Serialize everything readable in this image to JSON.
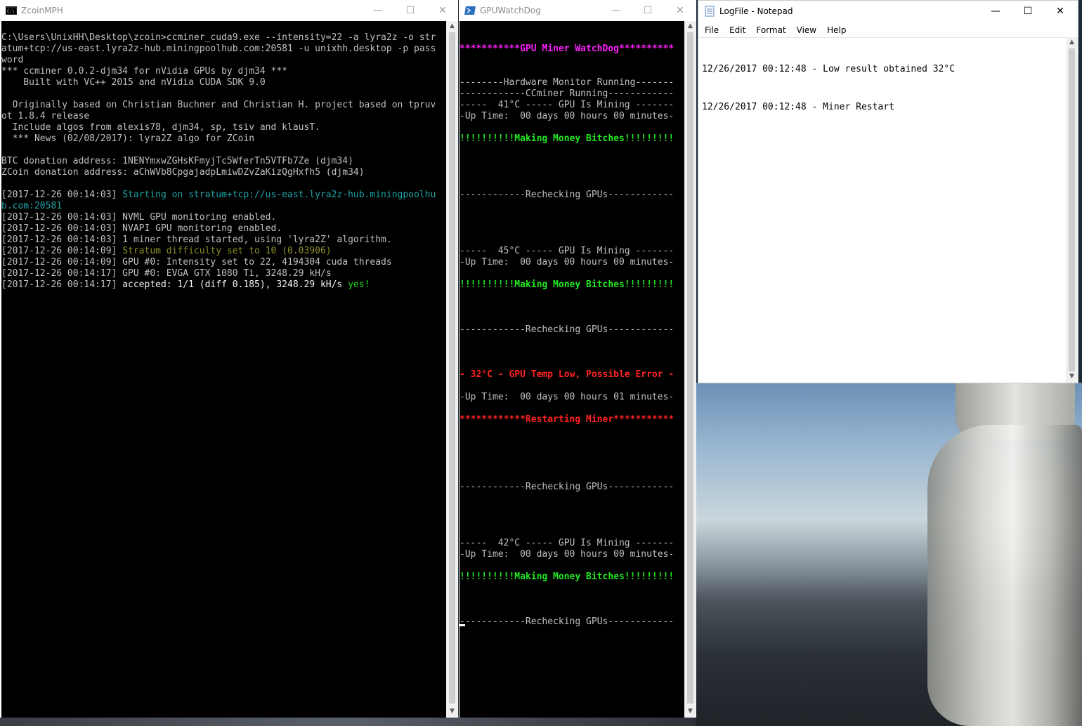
{
  "zcoin_window": {
    "title": "ZcoinMPH",
    "lines": [
      {
        "parts": [
          {
            "t": "C:\\Users\\UnixHH\\Desktop\\zcoin>ccminer_cuda9.exe --intensity=22 -a lyra2z -o str",
            "c": "c-grey"
          }
        ]
      },
      {
        "parts": [
          {
            "t": "atum+tcp://us-east.lyra2z-hub.miningpoolhub.com:20581 -u unixhh.desktop -p pass",
            "c": "c-grey"
          }
        ]
      },
      {
        "parts": [
          {
            "t": "word",
            "c": "c-grey"
          }
        ]
      },
      {
        "parts": [
          {
            "t": "*** ccminer 0.0.2-djm34 for nVidia GPUs by djm34 ***",
            "c": "c-grey"
          }
        ]
      },
      {
        "parts": [
          {
            "t": "    Built with VC++ 2015 and nVidia CUDA SDK 9.0",
            "c": "c-grey"
          }
        ]
      },
      {
        "parts": [
          {
            "t": "",
            "c": "c-grey"
          }
        ]
      },
      {
        "parts": [
          {
            "t": "  Originally based on Christian Buchner and Christian H. project based on tpruv",
            "c": "c-grey"
          }
        ]
      },
      {
        "parts": [
          {
            "t": "ot 1.8.4 release",
            "c": "c-grey"
          }
        ]
      },
      {
        "parts": [
          {
            "t": "  Include algos from alexis78, djm34, sp, tsiv and klausT.",
            "c": "c-grey"
          }
        ]
      },
      {
        "parts": [
          {
            "t": "  *** News (02/08/2017): lyra2Z algo for ZCoin",
            "c": "c-grey"
          }
        ]
      },
      {
        "parts": [
          {
            "t": "",
            "c": "c-grey"
          }
        ]
      },
      {
        "parts": [
          {
            "t": "BTC donation address: 1NENYmxwZGHsKFmyjTc5WferTn5VTFb7Ze (djm34)",
            "c": "c-grey"
          }
        ]
      },
      {
        "parts": [
          {
            "t": "ZCoin donation address: aChWVb8CpgajadpLmiwDZvZaKizQgHxfh5 (djm34)",
            "c": "c-grey"
          }
        ]
      },
      {
        "parts": [
          {
            "t": "",
            "c": "c-grey"
          }
        ]
      },
      {
        "parts": [
          {
            "t": "[2017-12-26 00:14:03] ",
            "c": "c-grey"
          },
          {
            "t": "Starting on stratum+tcp://us-east.lyra2z-hub.miningpoolhu",
            "c": "c-cyan"
          }
        ]
      },
      {
        "parts": [
          {
            "t": "b.com:20581",
            "c": "c-cyan"
          }
        ]
      },
      {
        "parts": [
          {
            "t": "[2017-12-26 00:14:03] NVML GPU monitoring enabled.",
            "c": "c-grey"
          }
        ]
      },
      {
        "parts": [
          {
            "t": "[2017-12-26 00:14:03] NVAPI GPU monitoring enabled.",
            "c": "c-grey"
          }
        ]
      },
      {
        "parts": [
          {
            "t": "[2017-12-26 00:14:03] 1 miner thread started, using 'lyra2Z' algorithm.",
            "c": "c-grey"
          }
        ]
      },
      {
        "parts": [
          {
            "t": "[2017-12-26 00:14:09] ",
            "c": "c-grey"
          },
          {
            "t": "Stratum difficulty set to 10 (0.03906)",
            "c": "c-yellow"
          }
        ]
      },
      {
        "parts": [
          {
            "t": "[2017-12-26 00:14:09] GPU #0: Intensity set to 22, 4194304 cuda threads",
            "c": "c-grey"
          }
        ]
      },
      {
        "parts": [
          {
            "t": "[2017-12-26 00:14:17] GPU #0: EVGA GTX 1080 Ti, 3248.29 kH/s",
            "c": "c-grey"
          }
        ]
      },
      {
        "parts": [
          {
            "t": "[2017-12-26 00:14:17] ",
            "c": "c-grey"
          },
          {
            "t": "accepted: 1/1 (diff 0.185), 3248.29 kH/s ",
            "c": "c-white"
          },
          {
            "t": "yes!",
            "c": "c-green"
          }
        ]
      }
    ]
  },
  "watchdog_window": {
    "title": "GPUWatchDog",
    "lines": [
      {
        "t": "",
        "c": "c-grey"
      },
      {
        "t": "",
        "c": "c-grey"
      },
      {
        "t": "***********GPU Miner WatchDog**********",
        "c": "c-magenta"
      },
      {
        "t": "",
        "c": "c-grey"
      },
      {
        "t": "",
        "c": "c-grey"
      },
      {
        "t": "--------Hardware Monitor Running-------",
        "c": "c-grey"
      },
      {
        "t": "------------CCminer Running------------",
        "c": "c-grey"
      },
      {
        "t": "-----  41°C ----- GPU Is Mining -------",
        "c": "c-grey"
      },
      {
        "t": "-Up Time:  00 days 00 hours 00 minutes-",
        "c": "c-grey"
      },
      {
        "t": "",
        "c": "c-grey"
      },
      {
        "t": "!!!!!!!!!!Making Money Bitches!!!!!!!!!",
        "c": "c-lgreen"
      },
      {
        "t": "",
        "c": "c-grey"
      },
      {
        "t": "",
        "c": "c-grey"
      },
      {
        "t": "",
        "c": "c-grey"
      },
      {
        "t": "",
        "c": "c-grey"
      },
      {
        "t": "------------Rechecking GPUs------------",
        "c": "c-grey"
      },
      {
        "t": "",
        "c": "c-grey"
      },
      {
        "t": "",
        "c": "c-grey"
      },
      {
        "t": "",
        "c": "c-grey"
      },
      {
        "t": "",
        "c": "c-grey"
      },
      {
        "t": "-----  45°C ----- GPU Is Mining -------",
        "c": "c-grey"
      },
      {
        "t": "-Up Time:  00 days 00 hours 00 minutes-",
        "c": "c-grey"
      },
      {
        "t": "",
        "c": "c-grey"
      },
      {
        "t": "!!!!!!!!!!Making Money Bitches!!!!!!!!!",
        "c": "c-lgreen"
      },
      {
        "t": "",
        "c": "c-grey"
      },
      {
        "t": "",
        "c": "c-grey"
      },
      {
        "t": "",
        "c": "c-grey"
      },
      {
        "t": "------------Rechecking GPUs------------",
        "c": "c-grey"
      },
      {
        "t": "",
        "c": "c-grey"
      },
      {
        "t": "",
        "c": "c-grey"
      },
      {
        "t": "",
        "c": "c-grey"
      },
      {
        "t": "- 32°C - GPU Temp Low, Possible Error -",
        "c": "c-red"
      },
      {
        "t": "",
        "c": "c-grey"
      },
      {
        "t": "-Up Time:  00 days 00 hours 01 minutes-",
        "c": "c-grey"
      },
      {
        "t": "",
        "c": "c-grey"
      },
      {
        "t": "************Restarting Miner***********",
        "c": "c-red"
      },
      {
        "t": "",
        "c": "c-grey"
      },
      {
        "t": "",
        "c": "c-grey"
      },
      {
        "t": "",
        "c": "c-grey"
      },
      {
        "t": "",
        "c": "c-grey"
      },
      {
        "t": "",
        "c": "c-grey"
      },
      {
        "t": "------------Rechecking GPUs------------",
        "c": "c-grey"
      },
      {
        "t": "",
        "c": "c-grey"
      },
      {
        "t": "",
        "c": "c-grey"
      },
      {
        "t": "",
        "c": "c-grey"
      },
      {
        "t": "",
        "c": "c-grey"
      },
      {
        "t": "-----  42°C ----- GPU Is Mining -------",
        "c": "c-grey"
      },
      {
        "t": "-Up Time:  00 days 00 hours 00 minutes-",
        "c": "c-grey"
      },
      {
        "t": "",
        "c": "c-grey"
      },
      {
        "t": "!!!!!!!!!!Making Money Bitches!!!!!!!!!",
        "c": "c-lgreen"
      },
      {
        "t": "",
        "c": "c-grey"
      },
      {
        "t": "",
        "c": "c-grey"
      },
      {
        "t": "",
        "c": "c-grey"
      },
      {
        "t": "------------Rechecking GPUs------------",
        "c": "c-grey"
      }
    ]
  },
  "notepad_window": {
    "title": "LogFile - Notepad",
    "menu": [
      "File",
      "Edit",
      "Format",
      "View",
      "Help"
    ],
    "lines": [
      "12/26/2017 00:12:48 - Low result obtained 32°C",
      "12/26/2017 00:12:48 - Miner Restart"
    ]
  },
  "controls": {
    "minimize": "—",
    "maximize": "☐",
    "close": "✕"
  }
}
